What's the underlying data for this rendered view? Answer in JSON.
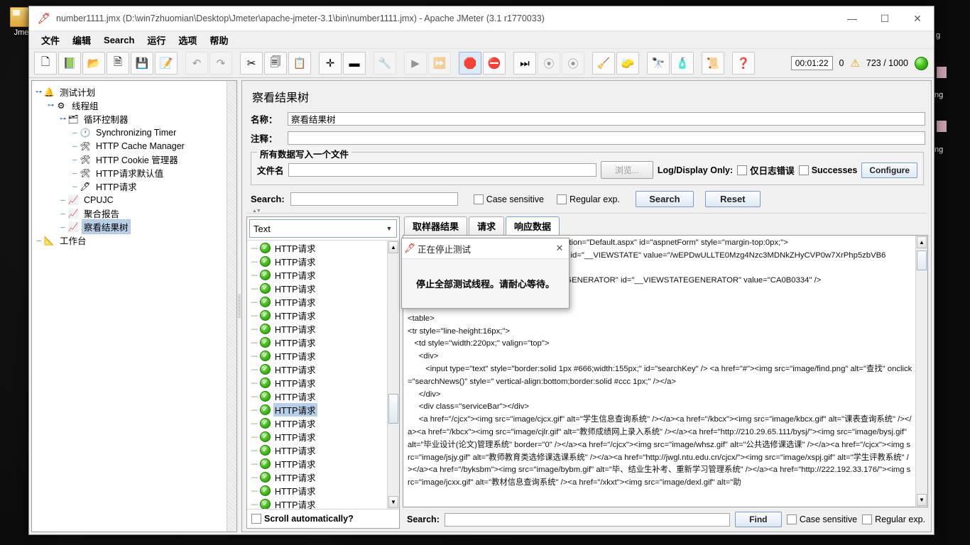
{
  "desktop": {
    "icon_label": "Jme",
    "right_labels": [
      "g",
      "ng"
    ]
  },
  "window": {
    "title": "number1111.jmx (D:\\win7zhuomian\\Desktop\\Jmeter\\apache-jmeter-3.1\\bin\\number1111.jmx) - Apache JMeter (3.1 r1770033)",
    "app_icon": "jmeter-feather-icon",
    "minimize": "—",
    "maximize": "☐",
    "close": "✕"
  },
  "menu": {
    "items": [
      {
        "label": "文件",
        "name": "menu-file"
      },
      {
        "label": "编辑",
        "name": "menu-edit"
      },
      {
        "label": "Search",
        "name": "menu-search"
      },
      {
        "label": "运行",
        "name": "menu-run"
      },
      {
        "label": "选项",
        "name": "menu-options"
      },
      {
        "label": "帮助",
        "name": "menu-help"
      }
    ]
  },
  "toolbar": {
    "buttons": [
      {
        "name": "new-button",
        "glyph": "🗋",
        "state": "normal"
      },
      {
        "name": "templates-button",
        "glyph": "📗",
        "state": "normal"
      },
      {
        "name": "open-button",
        "glyph": "📂",
        "state": "normal"
      },
      {
        "name": "close-button",
        "glyph": "🗎",
        "state": "normal"
      },
      {
        "name": "save-button",
        "glyph": "💾",
        "state": "normal"
      },
      {
        "name": "save-as-button",
        "glyph": "📝",
        "state": "normal"
      },
      {
        "name": "undo-button",
        "glyph": "↶",
        "state": "disabled"
      },
      {
        "name": "redo-button",
        "glyph": "↷",
        "state": "disabled"
      },
      {
        "name": "cut-button",
        "glyph": "✂",
        "state": "normal"
      },
      {
        "name": "copy-button",
        "glyph": "🗐",
        "state": "normal"
      },
      {
        "name": "paste-button",
        "glyph": "📋",
        "state": "normal"
      },
      {
        "name": "expand-all-button",
        "glyph": "✛",
        "state": "normal"
      },
      {
        "name": "collapse-all-button",
        "glyph": "▬",
        "state": "normal"
      },
      {
        "name": "toggle-button",
        "glyph": "🔧",
        "state": "disabled"
      },
      {
        "name": "start-button",
        "glyph": "▶",
        "state": "disabled"
      },
      {
        "name": "start-no-pauses-button",
        "glyph": "⏩",
        "state": "disabled"
      },
      {
        "name": "stop-button",
        "glyph": "🛑",
        "state": "selected"
      },
      {
        "name": "shutdown-button",
        "glyph": "⛔",
        "state": "normal"
      },
      {
        "name": "remote-start-all-button",
        "glyph": "⏭",
        "state": "normal"
      },
      {
        "name": "remote-stop-all-button",
        "glyph": "⦿",
        "state": "disabled"
      },
      {
        "name": "remote-shutdown-all-button",
        "glyph": "⦿",
        "state": "disabled"
      },
      {
        "name": "clear-button",
        "glyph": "🧹",
        "state": "normal"
      },
      {
        "name": "clear-all-button",
        "glyph": "🧽",
        "state": "normal"
      },
      {
        "name": "search-button",
        "glyph": "🔭",
        "state": "normal"
      },
      {
        "name": "reset-search-button",
        "glyph": "🧴",
        "state": "normal"
      },
      {
        "name": "function-helper-button",
        "glyph": "📜",
        "state": "normal"
      },
      {
        "name": "help-button",
        "glyph": "❓",
        "state": "normal"
      }
    ],
    "elapsed_time": "00:01:22",
    "warning_count": "0",
    "warning_icon": "warning-triangle-icon",
    "threads": "723 / 1000",
    "running_indicator": "running-green-ball"
  },
  "tree": {
    "nodes": [
      {
        "label": "测试计划",
        "depth": 0,
        "handle": "collapse",
        "icon": "test-plan-icon",
        "selected": false
      },
      {
        "label": "线程组",
        "depth": 1,
        "handle": "collapse",
        "icon": "thread-group-icon",
        "selected": false
      },
      {
        "label": "循环控制器",
        "depth": 2,
        "handle": "collapse",
        "icon": "loop-controller-icon",
        "selected": false
      },
      {
        "label": "Synchronizing Timer",
        "depth": 3,
        "handle": "leaf",
        "icon": "timer-icon",
        "selected": false
      },
      {
        "label": "HTTP Cache Manager",
        "depth": 3,
        "handle": "leaf",
        "icon": "config-element-icon",
        "selected": false
      },
      {
        "label": "HTTP Cookie 管理器",
        "depth": 3,
        "handle": "leaf",
        "icon": "config-element-icon",
        "selected": false
      },
      {
        "label": "HTTP请求默认值",
        "depth": 3,
        "handle": "leaf",
        "icon": "config-element-icon",
        "selected": false
      },
      {
        "label": "HTTP请求",
        "depth": 3,
        "handle": "leaf",
        "icon": "http-sampler-icon",
        "selected": false
      },
      {
        "label": "CPUJC",
        "depth": 2,
        "handle": "leaf",
        "icon": "listener-icon",
        "selected": false
      },
      {
        "label": "聚合报告",
        "depth": 2,
        "handle": "leaf",
        "icon": "listener-icon",
        "selected": false
      },
      {
        "label": "察看结果树",
        "depth": 2,
        "handle": "leaf",
        "icon": "listener-icon",
        "selected": true
      },
      {
        "label": "工作台",
        "depth": 0,
        "handle": "leaf",
        "icon": "workbench-icon",
        "selected": false
      }
    ]
  },
  "panel": {
    "title": "察看结果树",
    "name_label": "名称：",
    "name_value": "察看结果树",
    "comment_label": "注释：",
    "comment_value": "",
    "group_title": "所有数据写入一个文件",
    "filename_label": "文件名",
    "filename_value": "",
    "browse_button": "浏览...",
    "log_display_only_label": "Log/Display Only:",
    "errors_only_checkbox": "仅日志错误",
    "successes_checkbox": "Successes",
    "configure_button": "Configure",
    "search_label": "Search:",
    "search_value": "",
    "case_sensitive_checkbox": "Case sensitive",
    "regular_exp_checkbox": "Regular exp.",
    "search_button": "Search",
    "reset_button": "Reset"
  },
  "results": {
    "render_selector": "Text",
    "rows": [
      {
        "label": "HTTP请求",
        "status": "success",
        "selected": false
      },
      {
        "label": "HTTP请求",
        "status": "success",
        "selected": false
      },
      {
        "label": "HTTP请求",
        "status": "success",
        "selected": false
      },
      {
        "label": "HTTP请求",
        "status": "success",
        "selected": false
      },
      {
        "label": "HTTP请求",
        "status": "success",
        "selected": false
      },
      {
        "label": "HTTP请求",
        "status": "success",
        "selected": false
      },
      {
        "label": "HTTP请求",
        "status": "success",
        "selected": false
      },
      {
        "label": "HTTP请求",
        "status": "success",
        "selected": false
      },
      {
        "label": "HTTP请求",
        "status": "success",
        "selected": false
      },
      {
        "label": "HTTP请求",
        "status": "success",
        "selected": false
      },
      {
        "label": "HTTP请求",
        "status": "success",
        "selected": false
      },
      {
        "label": "HTTP请求",
        "status": "success",
        "selected": false
      },
      {
        "label": "HTTP请求",
        "status": "success",
        "selected": true
      },
      {
        "label": "HTTP请求",
        "status": "success",
        "selected": false
      },
      {
        "label": "HTTP请求",
        "status": "success",
        "selected": false
      },
      {
        "label": "HTTP请求",
        "status": "success",
        "selected": false
      },
      {
        "label": "HTTP请求",
        "status": "success",
        "selected": false
      },
      {
        "label": "HTTP请求",
        "status": "success",
        "selected": false
      },
      {
        "label": "HTTP请求",
        "status": "success",
        "selected": false
      },
      {
        "label": "HTTP请求",
        "status": "success",
        "selected": false
      }
    ],
    "scroll_automatically": "Scroll automatically?"
  },
  "view": {
    "tabs": [
      {
        "label": "取样器结果",
        "name": "tab-sampler-result",
        "active": false
      },
      {
        "label": "请求",
        "name": "tab-request",
        "active": false
      },
      {
        "label": "响应数据",
        "name": "tab-response-data",
        "active": true
      }
    ],
    "response_text": "<form name=\"aspnetForm\" method=\"post\" action=\"Default.aspx\" id=\"aspnetForm\" style=\"margin-top:0px;\">\n<input type=\"hidden\" name=\"__VIEWSTATE\" id=\"__VIEWSTATE\" value=\"/wEPDwULLTE0Mzg4Nzc3MDNkZHyCVP0w7XrPhp5zbVB6\n\n<input type=\"hidden\" name=\"__VIEWSTATEGENERATOR\" id=\"__VIEWSTATEGENERATOR\" value=\"CA0B0334\" />\n</div>\n\n<table>\n<tr style=\"line-height:16px;\">\n   <td style=\"width:220px;\" valign=\"top\">\n     <div>\n        <input type=\"text\" style=\"border:solid 1px #666;width:155px;\" id=\"searchKey\" /> <a href=\"#\"><img src=\"image/find.png\" alt=\"查找\" onclick=\"searchNews()\" style=\" vertical-align:bottom;border:solid #ccc 1px;\" /></a>\n     </div>\n     <div class=\"serviceBar\"></div>\n     <a href=\"/cjcx\"><img src=\"image/cjcx.gif\" alt=\"学生信息查询系统\" /></a><a href=\"/kbcx\"><img src=\"image/kbcx.gif\" alt=\"课表查询系统\" /></a><a href=\"/kbcx\"><img src=\"image/cjlr.gif\" alt=\"教师成绩网上录入系统\" /></a><a href=\"http://210.29.65.111/bysj/\"><img src=\"image/bysj.gif\" alt=\"毕业设计(论文)管理系统\" border=\"0\" /></a><a href=\"/cjcx\"><img src=\"image/whsz.gif\" alt=\"公共选修课选课\" /></a><a href=\"/cjcx\"><img src=\"image/jsjy.gif\" alt=\"教师教育类选修课选课系统\" /></a><a href=\"http://jwgl.ntu.edu.cn/cjcx/\"><img src=\"image/xspj.gif\" alt=\"学生评教系统\" /></a><a href=\"/byksbm\"><img src=\"image/bybm.gif\" alt=\"毕、结业生补考、重新学习管理系统\" /></a><a href=\"http://222.192.33.176/\"><img src=\"image/jcxx.gif\" alt=\"教材信息查询系统\" /><a href=\"/xkxt\"><img src=\"image/dexl.gif\" alt=\"助",
    "find_label": "Search:",
    "find_value": "",
    "find_button": "Find",
    "case_sensitive_checkbox": "Case sensitive",
    "regular_exp_checkbox": "Regular exp."
  },
  "dialog": {
    "icon": "jmeter-feather-icon",
    "title": "正在停止测试",
    "close": "✕",
    "message": "停止全部测试线程。请耐心等待。"
  }
}
